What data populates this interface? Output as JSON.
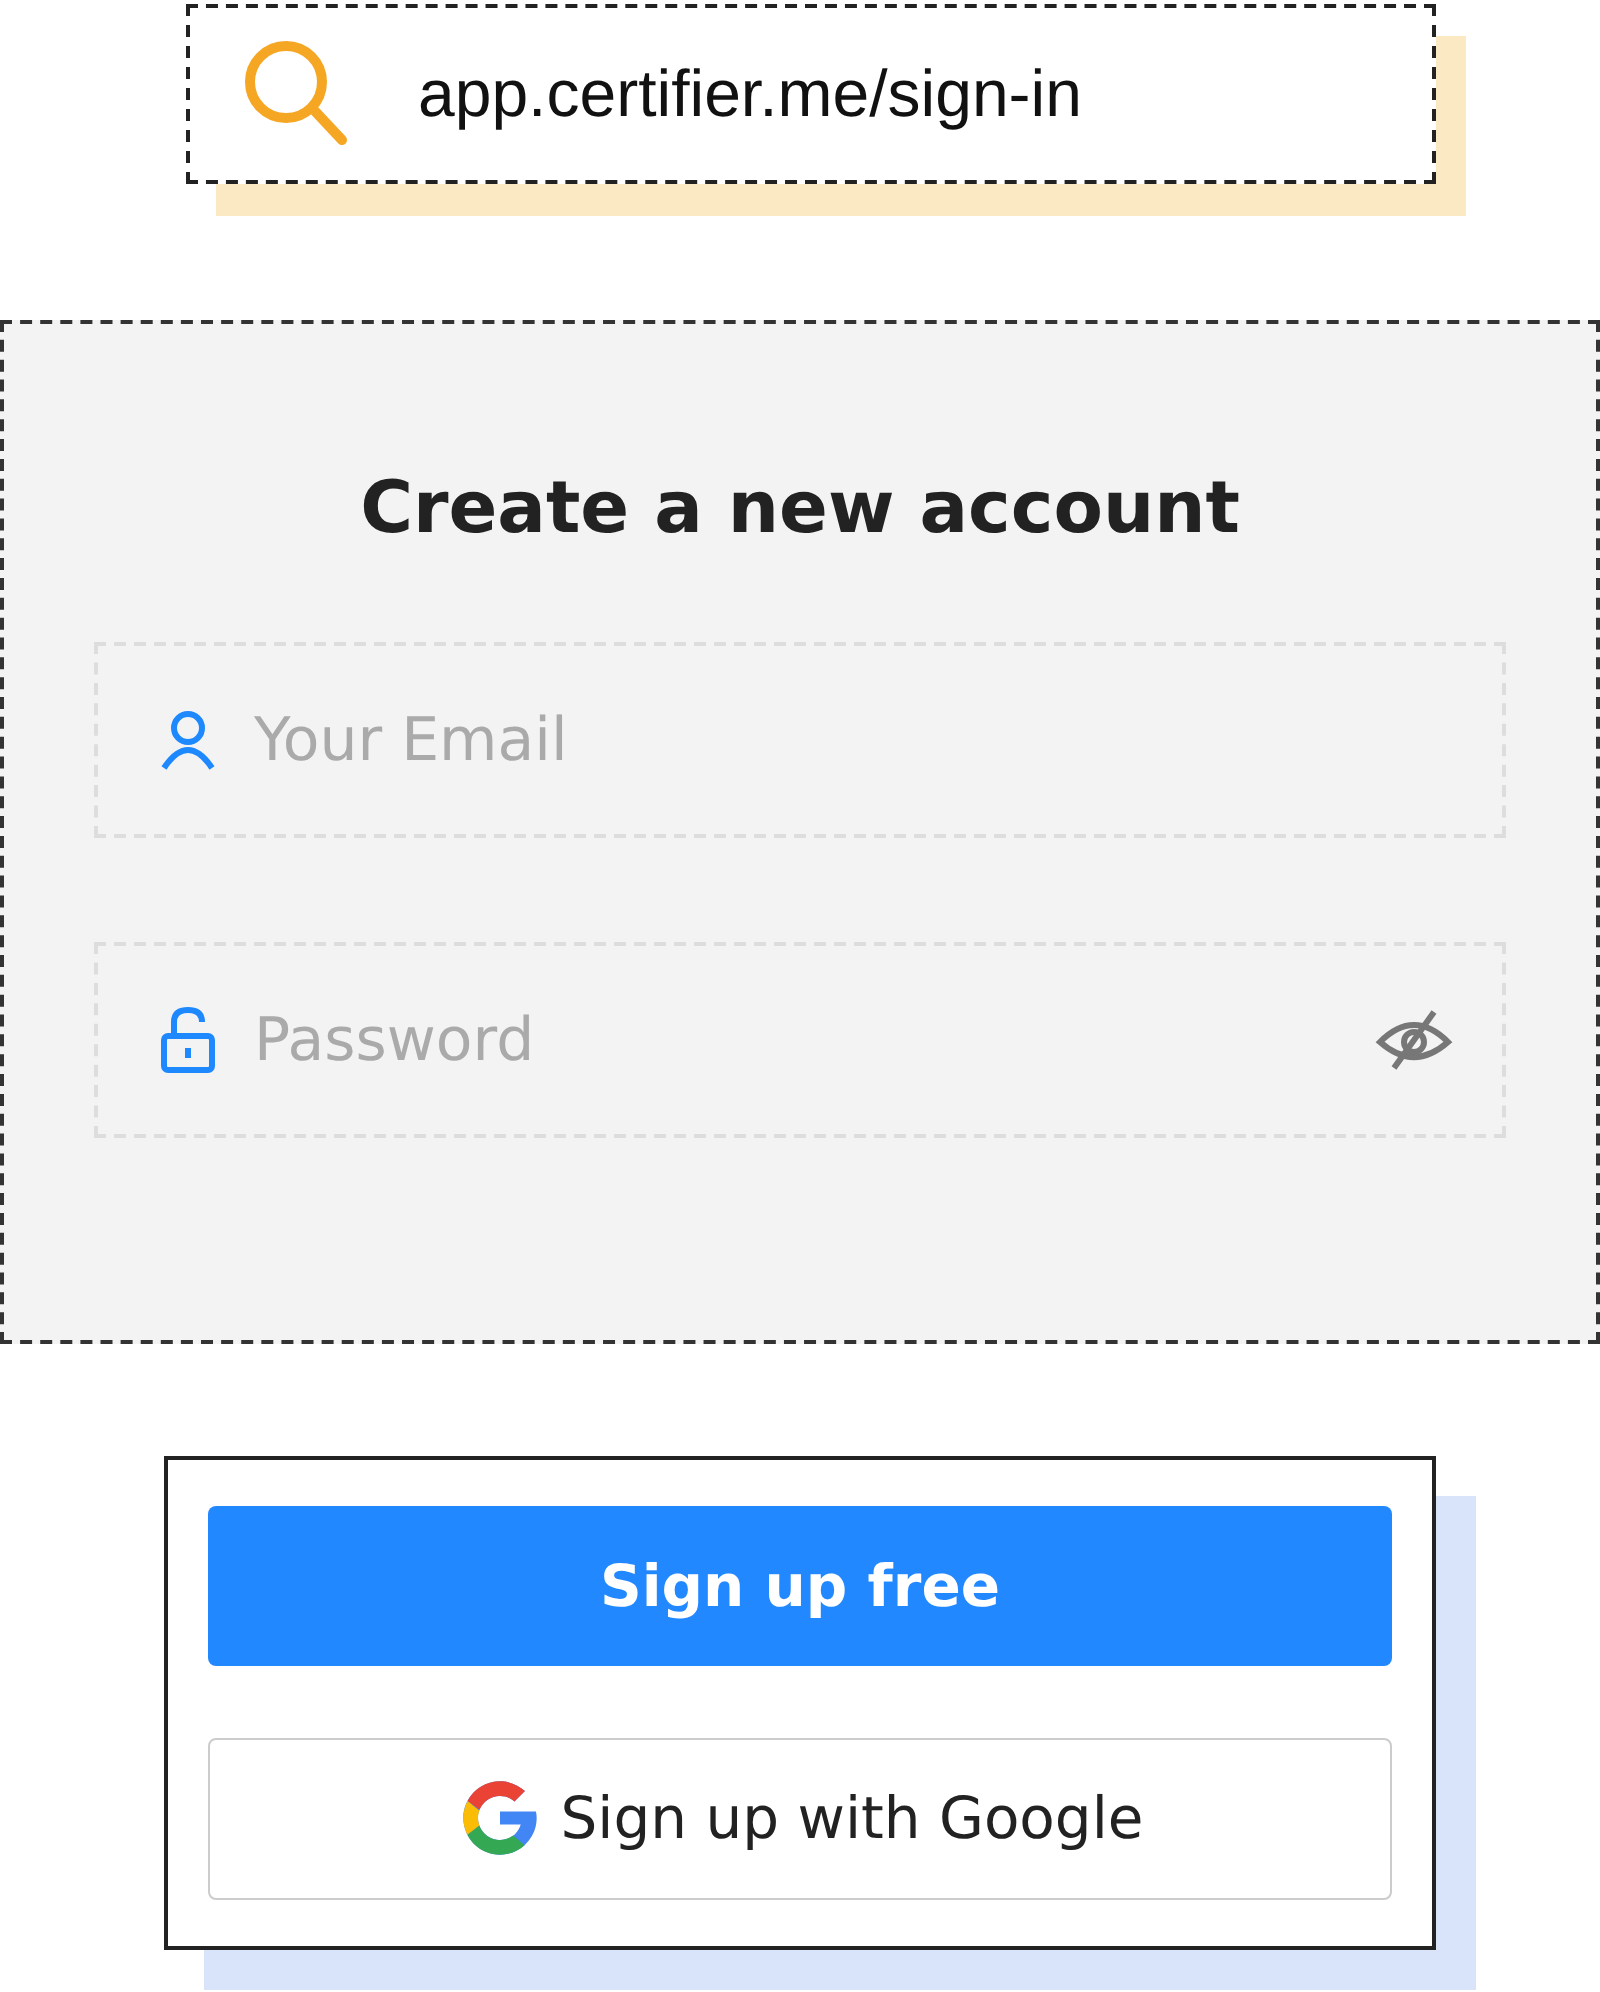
{
  "address_bar": {
    "url": "app.certifier.me/sign-in"
  },
  "form": {
    "title": "Create a new account",
    "fields": [
      {
        "kind": "email",
        "placeholder": "Your Email"
      },
      {
        "kind": "password",
        "placeholder": "Password"
      }
    ]
  },
  "buttons": [
    {
      "kind": "primary",
      "label": "Sign up free"
    },
    {
      "kind": "google",
      "label": "Sign up with Google"
    }
  ]
}
